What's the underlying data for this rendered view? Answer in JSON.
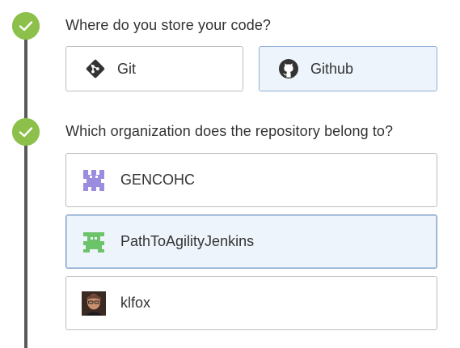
{
  "steps": [
    {
      "question": "Where do you store your code?",
      "status_icon": "check-circle-icon",
      "options": [
        {
          "label": "Git",
          "icon": "git-icon",
          "selected": false
        },
        {
          "label": "Github",
          "icon": "github-icon",
          "selected": true
        }
      ]
    },
    {
      "question": "Which organization does the repository belong to?",
      "status_icon": "check-circle-icon",
      "options": [
        {
          "label": "GENCOHC",
          "icon": "purple-pixel-avatar",
          "selected": false
        },
        {
          "label": "PathToAgilityJenkins",
          "icon": "green-pixel-avatar",
          "selected": true
        },
        {
          "label": "klfox",
          "icon": "user-photo-avatar",
          "selected": false
        }
      ]
    }
  ],
  "colors": {
    "check_green": "#8cc04b",
    "timeline": "#595959",
    "selected_bg": "#eef4fb",
    "selected_border": "#8fb0d6",
    "purple_avatar": "#9b8ce0",
    "green_avatar": "#6cc36a"
  }
}
